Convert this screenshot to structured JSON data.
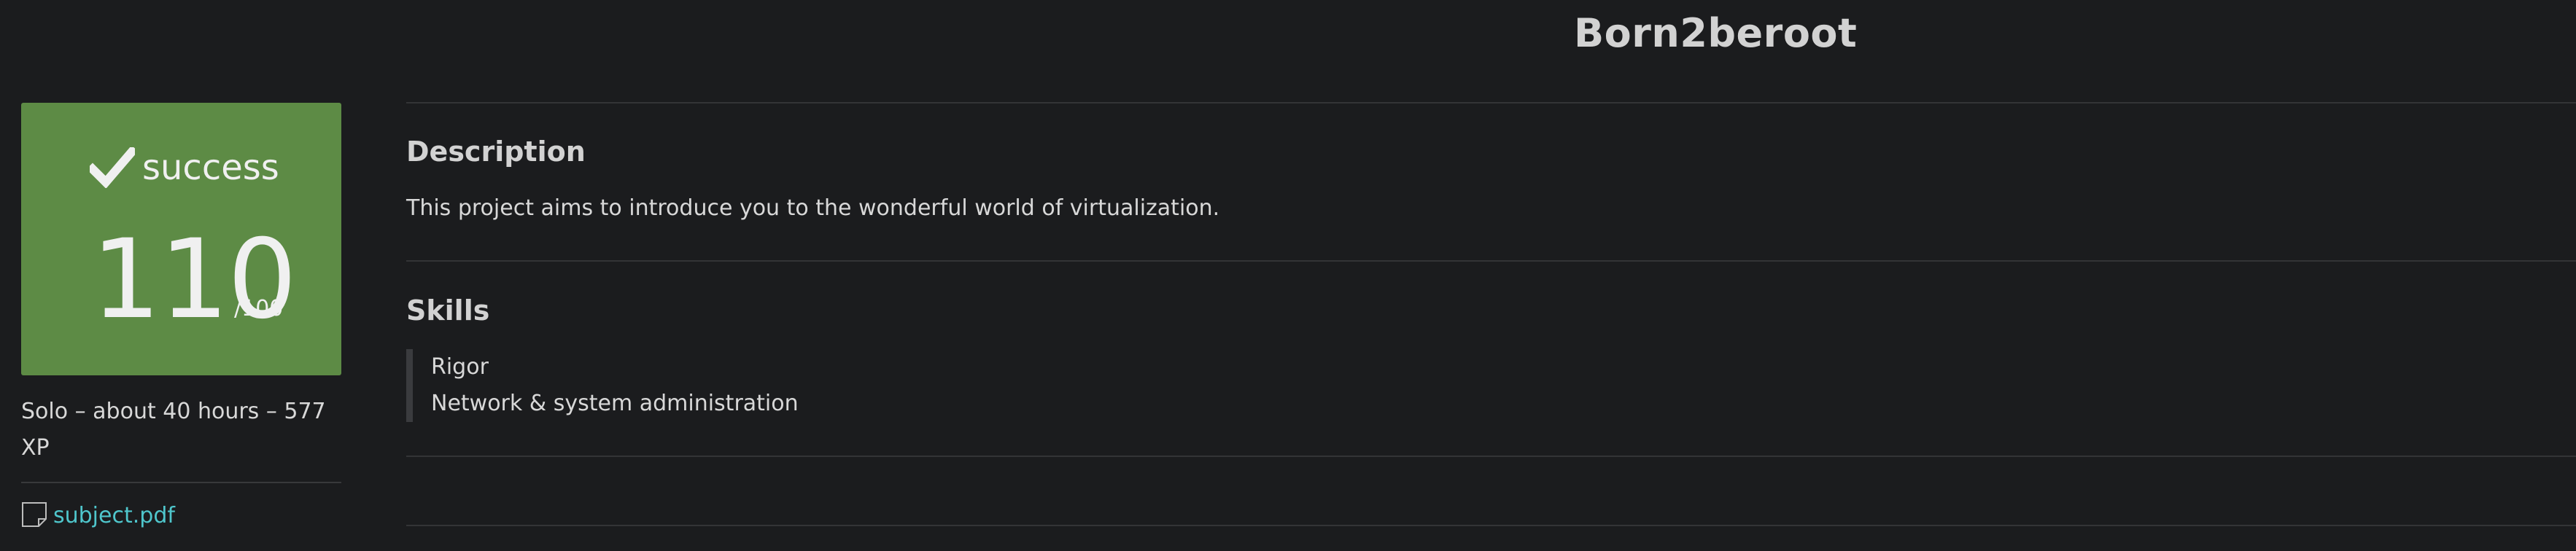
{
  "project": {
    "title": "Born2beroot"
  },
  "result": {
    "status": "success",
    "score": "110",
    "max_score": "/100",
    "status_color": "#5d8b45"
  },
  "meta": {
    "info": "Solo – about 40 hours – 577 XP"
  },
  "attachment": {
    "icon": "document-icon",
    "name": "subject.pdf",
    "link_color": "#4fc6cc"
  },
  "description": {
    "heading": "Description",
    "text": "This project aims to introduce you to the wonderful world of virtualization."
  },
  "skills": {
    "heading": "Skills",
    "items": [
      "Rigor",
      "Network & system administration"
    ]
  },
  "icons": {
    "status": "checkmark-icon"
  }
}
